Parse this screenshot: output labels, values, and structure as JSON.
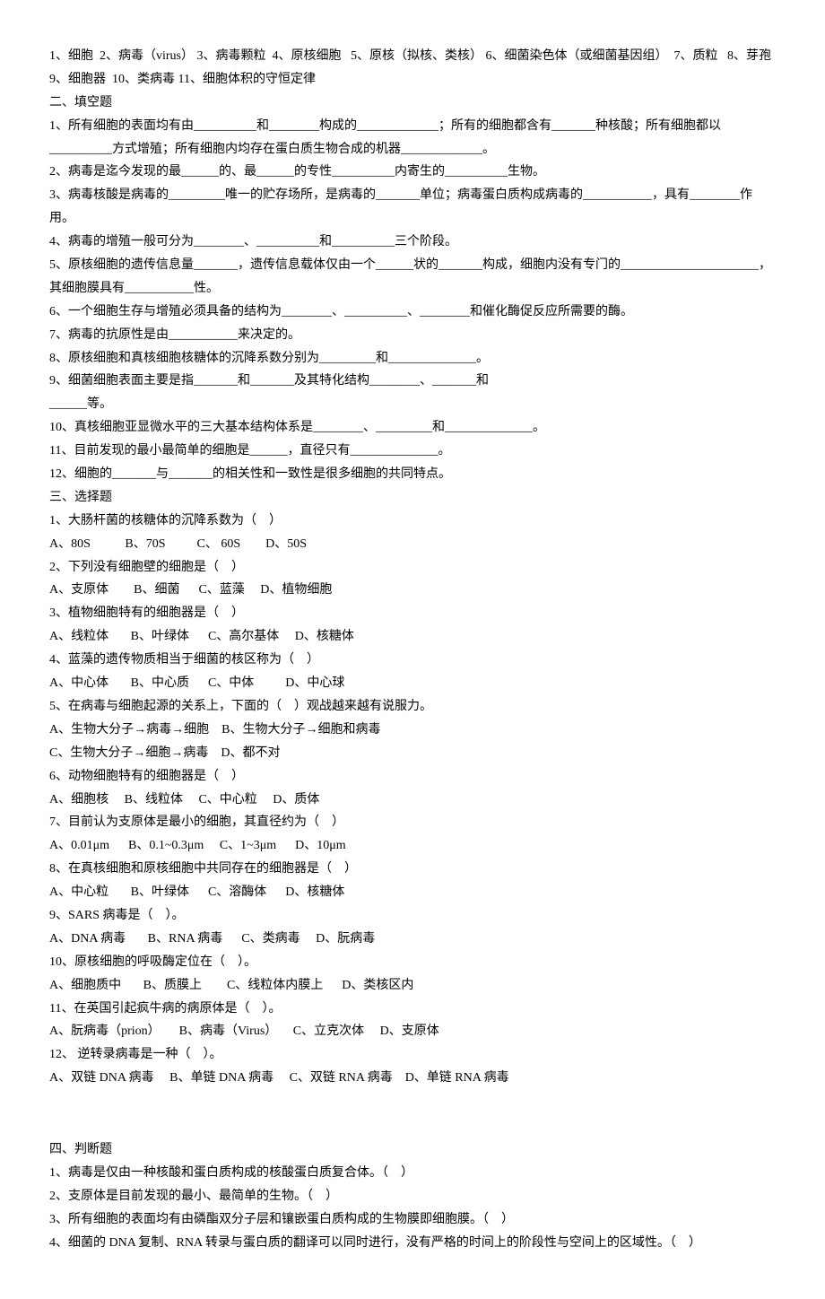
{
  "lines": [
    "1、细胞  2、病毒（virus） 3、病毒颗粒  4、原核细胞   5、原核（拟核、类核） 6、细菌染色体（或细菌基因组）  7、质粒   8、芽孢   9、细胞器  10、类病毒 11、细胞体积的守恒定律",
    "二、填空题",
    "1、所有细胞的表面均有由__________和________构成的_____________；所有的细胞都含有_______种核酸；所有细胞都以__________方式增殖；所有细胞内均存在蛋白质生物合成的机器_____________。",
    "2、病毒是迄今发现的最______的、最______的专性__________内寄生的__________生物。",
    "3、病毒核酸是病毒的_________唯一的贮存场所，是病毒的_______单位；病毒蛋白质构成病毒的___________，具有________作用。",
    "4、病毒的增殖一般可分为________、__________和__________三个阶段。",
    "5、原核细胞的遗传信息量_______，遗传信息载体仅由一个______状的_______构成，细胞内没有专门的______________________，其细胞膜具有___________性。",
    "6、一个细胞生存与增殖必须具备的结构为________、__________、________和催化酶促反应所需要的酶。",
    "7、病毒的抗原性是由___________来决定的。",
    "8、原核细胞和真核细胞核糖体的沉降系数分别为_________和______________。",
    "9、细菌细胞表面主要是指_______和_______及其特化结构________、_______和",
    "______等。",
    "10、真核细胞亚显微水平的三大基本结构体系是________、_________和______________。",
    "11、目前发现的最小最简单的细胞是______，直径只有______________。",
    "12、细胞的_______与_______的相关性和一致性是很多细胞的共同特点。",
    "三、选择题",
    "1、大肠杆菌的核糖体的沉降系数为（    ）",
    "A、80S           B、70S          C、 60S        D、50S",
    "2、下列没有细胞壁的细胞是（    ）",
    "A、支原体        B、细菌      C、蓝藻     D、植物细胞",
    "3、植物细胞特有的细胞器是（    ）",
    "A、线粒体       B、叶绿体      C、高尔基体     D、核糖体",
    "4、蓝藻的遗传物质相当于细菌的核区称为（    ）",
    "A、中心体       B、中心质      C、中体          D、中心球",
    "5、在病毒与细胞起源的关系上，下面的（    ）观战越来越有说服力。",
    "A、生物大分子→病毒→细胞    B、生物大分子→细胞和病毒",
    "C、生物大分子→细胞→病毒    D、都不对",
    "6、动物细胞特有的细胞器是（    ）",
    "A、细胞核     B、线粒体     C、中心粒     D、质体",
    "7、目前认为支原体是最小的细胞，其直径约为（    ）",
    "A、0.01μm      B、0.1~0.3μm     C、1~3μm      D、10μm",
    "8、在真核细胞和原核细胞中共同存在的细胞器是（    ）",
    "A、中心粒       B、叶绿体      C、溶酶体      D、核糖体",
    "9、SARS 病毒是（    ）。",
    "A、DNA 病毒       B、RNA 病毒      C、类病毒     D、朊病毒",
    "10、原核细胞的呼吸酶定位在（    ）。",
    "A、细胞质中       B、质膜上        C、线粒体内膜上      D、类核区内",
    "11、在英国引起疯牛病的病原体是（    ）。",
    "A、朊病毒（prion）      B、病毒（Virus）     C、立克次体     D、支原体",
    "12、 逆转录病毒是一种（    ）。",
    "A、双链 DNA 病毒     B、单链 DNA 病毒     C、双链 RNA 病毒    D、单链 RNA 病毒",
    "",
    "四、判断题",
    "1、病毒是仅由一种核酸和蛋白质构成的核酸蛋白质复合体。（    ）",
    "2、支原体是目前发现的最小、最简单的生物。（    ）",
    "3、所有细胞的表面均有由磷酯双分子层和镶嵌蛋白质构成的生物膜即细胞膜。（    ）",
    "4、细菌的 DNA 复制、RNA 转录与蛋白质的翻译可以同时进行，没有严格的时间上的阶段性与空间上的区域性。（    ）"
  ]
}
